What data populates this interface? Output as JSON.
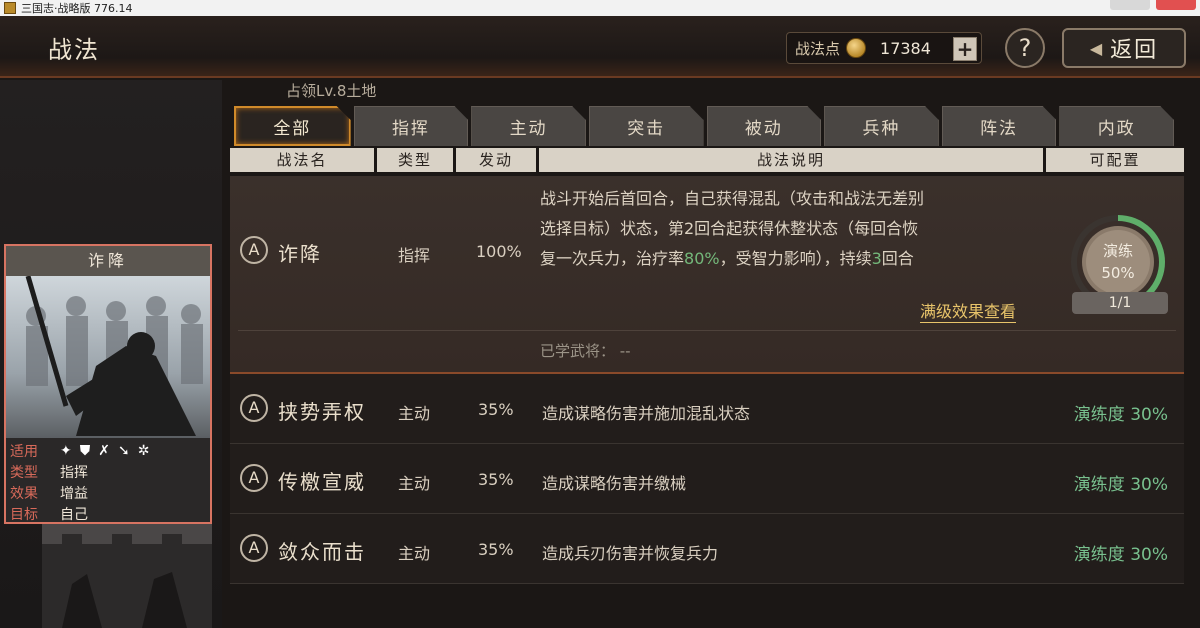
{
  "window": {
    "title": "三国志·战略版 776.14"
  },
  "header": {
    "title": "战法",
    "points_label": "战法点",
    "points_value": "17384",
    "plus": "+",
    "help": "?",
    "back": "返回"
  },
  "subtitle": "占领Lv.8土地",
  "tabs": [
    "全部",
    "指挥",
    "主动",
    "突击",
    "被动",
    "兵种",
    "阵法",
    "内政"
  ],
  "columns": {
    "name": "战法名",
    "type": "类型",
    "rate": "发动",
    "desc": "战法说明",
    "config": "可配置"
  },
  "card": {
    "name": "诈降",
    "attrs": [
      {
        "key": "适用",
        "value": ""
      },
      {
        "key": "类型",
        "value": "指挥"
      },
      {
        "key": "效果",
        "value": "增益"
      },
      {
        "key": "目标",
        "value": "自己"
      }
    ]
  },
  "expanded": {
    "badge": "A",
    "name": "诈降",
    "type": "指挥",
    "rate": "100%",
    "desc_lines": [
      "战斗开始后首回合，自己获得混乱（攻击和战法无差别",
      "选择目标）状态，第2回合起获得休整状态（每回合恢",
      "复一次兵力，治疗率"
    ],
    "desc_highlight": "80%",
    "desc_tail": "，受智力影响），持续",
    "desc_highlight2": "3",
    "desc_end": "回合",
    "full_link": "满级效果查看",
    "learned": "已学武将：  --",
    "train_label": "演练",
    "train_percent": "50%",
    "train_progress": 0.5,
    "train_count": "1/1"
  },
  "rows": [
    {
      "badge": "A",
      "name": "挟势弄权",
      "type": "主动",
      "rate": "35%",
      "desc": "造成谋略伤害并施加混乱状态",
      "level": "演练度 30%"
    },
    {
      "badge": "A",
      "name": "传檄宣威",
      "type": "主动",
      "rate": "35%",
      "desc": "造成谋略伤害并缴械",
      "level": "演练度 30%"
    },
    {
      "badge": "A",
      "name": "敛众而击",
      "type": "主动",
      "rate": "35%",
      "desc": "造成兵刃伤害并恢复兵力",
      "level": "演练度 30%"
    }
  ]
}
